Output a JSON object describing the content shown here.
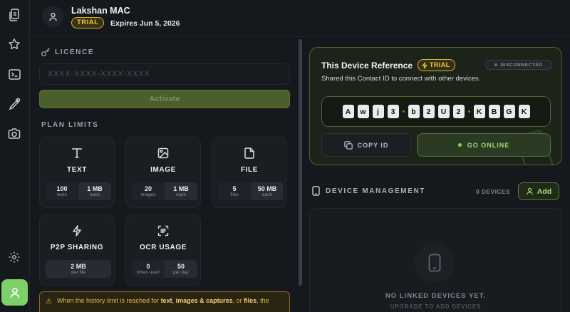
{
  "header": {
    "user_name": "Lakshan MAC",
    "plan_badge": "TRIAL",
    "expires": "Expires Jun 5, 2026"
  },
  "rail": {
    "icons": [
      "clipboard-icon",
      "star-icon",
      "terminal-icon",
      "eyedropper-icon",
      "camera-icon",
      "settings-icon",
      "user-icon"
    ]
  },
  "licence": {
    "title": "LICENCE",
    "placeholder": "XXXX-XXXX-XXXX-XXXX",
    "activate_label": "Activate"
  },
  "plan_limits": {
    "title": "PLAN LIMITS",
    "cards": [
      {
        "name": "TEXT",
        "icon": "text-icon",
        "stats": [
          {
            "value": "100",
            "label": "texts"
          },
          {
            "value": "1 MB",
            "label": "each"
          }
        ]
      },
      {
        "name": "IMAGE",
        "icon": "image-icon",
        "stats": [
          {
            "value": "20",
            "label": "images"
          },
          {
            "value": "1 MB",
            "label": "each"
          }
        ]
      },
      {
        "name": "FILE",
        "icon": "file-icon",
        "stats": [
          {
            "value": "5",
            "label": "files"
          },
          {
            "value": "50 MB",
            "label": "each"
          }
        ]
      },
      {
        "name": "P2P SHARING",
        "icon": "lightning-icon",
        "stats": [
          {
            "value": "2 MB",
            "label": "per file"
          }
        ]
      },
      {
        "name": "OCR USAGE",
        "icon": "ocr-scan-icon",
        "stats": [
          {
            "value": "0",
            "label": "times used"
          },
          {
            "value": "50",
            "label": "per day"
          }
        ]
      }
    ]
  },
  "warning": {
    "prefix": "When the history limit is reached for ",
    "b1": "text",
    "sep1": ", ",
    "b2": "images & captures",
    "sep2": ", or ",
    "b3": "files",
    "suffix": ", the"
  },
  "device": {
    "title": "This Device Reference",
    "badge": "TRIAL",
    "status": "DISCONNECTED",
    "subtitle": "Shared this Contact ID to connect with other devices.",
    "id_chars": [
      "A",
      "w",
      "j",
      "3",
      "b",
      "2",
      "U",
      "2",
      "K",
      "B",
      "G",
      "K"
    ],
    "copy_label": "COPY ID",
    "online_label": "GO ONLINE"
  },
  "device_management": {
    "title": "DEVICE MANAGEMENT",
    "count": "0 DEVICES",
    "add_label": "Add",
    "empty_title": "NO LINKED DEVICES YET.",
    "empty_sub": "UPGRADE TO ADD DEVICES"
  },
  "colors": {
    "accent_green": "#7fcf6a",
    "trial_yellow": "#f0c93a",
    "background": "#15181d"
  }
}
